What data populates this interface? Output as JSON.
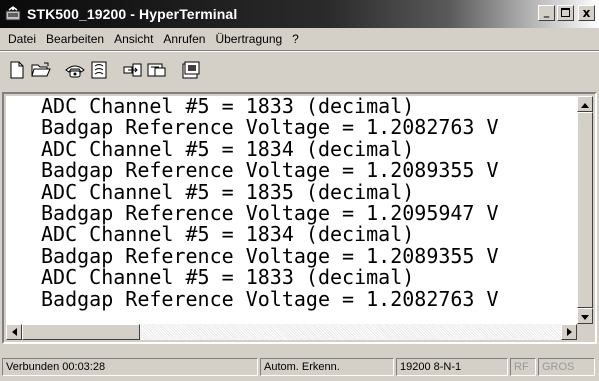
{
  "window": {
    "title": "STK500_19200 - HyperTerminal",
    "min_label": "_",
    "max_label": "□",
    "close_label": "x"
  },
  "menu": {
    "items": [
      "Datei",
      "Bearbeiten",
      "Ansicht",
      "Anrufen",
      "Übertragung",
      "?"
    ]
  },
  "toolbar": {
    "buttons": [
      {
        "name": "new-icon"
      },
      {
        "name": "open-folder-icon"
      },
      {
        "name": "call-icon"
      },
      {
        "name": "properties-call-icon"
      },
      {
        "name": "send-icon"
      },
      {
        "name": "receive-icon"
      },
      {
        "name": "properties-icon"
      }
    ]
  },
  "terminal": {
    "lines": [
      "ADC Channel #5 = 1833 (decimal)",
      "Badgap Reference Voltage = 1.2082763 V",
      "ADC Channel #5 = 1834 (decimal)",
      "Badgap Reference Voltage = 1.2089355 V",
      "ADC Channel #5 = 1835 (decimal)",
      "Badgap Reference Voltage = 1.2095947 V",
      "ADC Channel #5 = 1834 (decimal)",
      "Badgap Reference Voltage = 1.2089355 V",
      "ADC Channel #5 = 1833 (decimal)",
      "Badgap Reference Voltage = 1.2082763 V"
    ]
  },
  "status": {
    "connected": "Verbunden 00:03:28",
    "detect": "Autom. Erkenn.",
    "settings": "19200 8-N-1",
    "rf": "RF",
    "caps": "GROS"
  }
}
